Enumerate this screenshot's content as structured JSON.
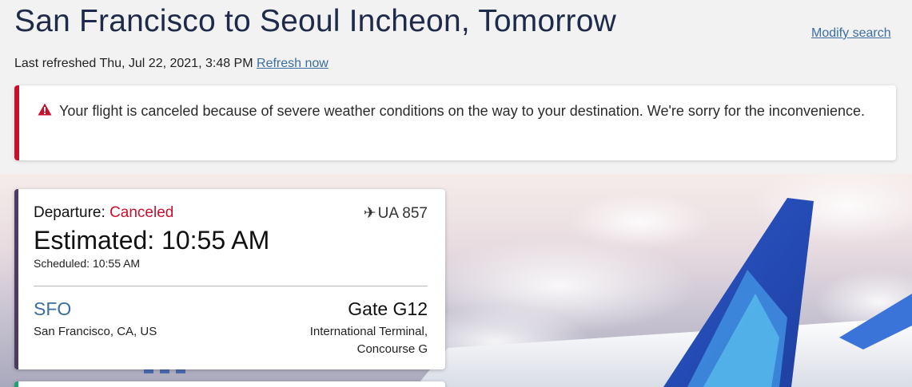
{
  "header": {
    "title": "San Francisco to Seoul Incheon, Tomorrow",
    "modify_label": "Modify search",
    "refreshed_text": "Last refreshed Thu, Jul 22, 2021, 3:48 PM",
    "refresh_label": "Refresh now"
  },
  "alert": {
    "icon": "warning-triangle-icon",
    "message": "Your flight is canceled because of severe weather conditions on the way to your destination. We're sorry for the inconvenience.",
    "accent_color": "#c8102e"
  },
  "departure": {
    "label": "Departure:",
    "status": "Canceled",
    "flight_icon": "plane-icon",
    "flight_number": "UA 857",
    "estimated": "Estimated: 10:55 AM",
    "scheduled": "Scheduled: 10:55 AM",
    "airport_code": "SFO",
    "airport_city": "San Francisco, CA, US",
    "gate": "Gate G12",
    "terminal": "International Terminal, Concourse G"
  },
  "colors": {
    "link": "#3a6ea5",
    "title": "#1d2a49",
    "departure_bar": "#4e3b63",
    "arrival_bar": "#1aa36f"
  }
}
